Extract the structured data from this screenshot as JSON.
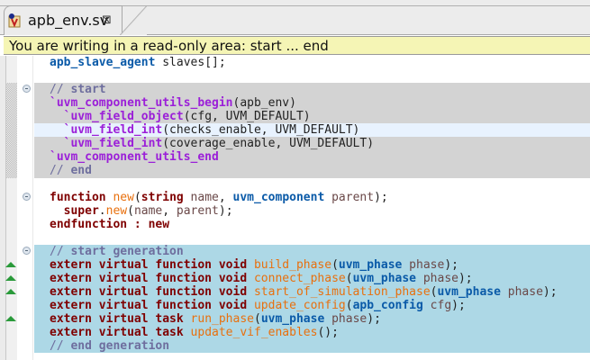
{
  "tab": {
    "label": "apb_env.sv",
    "icon": "verilog-file-icon",
    "close_icon": "close-icon"
  },
  "tooltip": {
    "text": "You are writing in a read-only area: start ... end"
  },
  "colors": {
    "readonly_block": "#d3d3d3",
    "generated_block": "#add8e6",
    "tooltip_bg": "#f5f5b5",
    "current_line": "#e8f2fe"
  },
  "code_lines": [
    [
      [
        "ty",
        "apb_slave_agent"
      ],
      [
        "p",
        " slaves[];"
      ]
    ],
    [],
    [
      [
        "cm",
        "// "
      ],
      [
        "cmb",
        "start"
      ]
    ],
    [
      [
        "mc",
        "`uvm_component_utils_begin"
      ],
      [
        "p",
        "(apb_env)"
      ]
    ],
    [
      [
        "p",
        "  "
      ],
      [
        "mc",
        "`uvm_field_object"
      ],
      [
        "p",
        "(cfg, UVM_DEFAULT)"
      ]
    ],
    [
      [
        "p",
        "  "
      ],
      [
        "mc",
        "`uvm_field_int"
      ],
      [
        "p",
        "(checks_enable, UVM_DEFAULT)"
      ]
    ],
    [
      [
        "p",
        "  "
      ],
      [
        "mc",
        "`uvm_field_int"
      ],
      [
        "p",
        "(coverage_enable, UVM_DEFAULT)"
      ]
    ],
    [
      [
        "mc",
        "`uvm_component_utils_end"
      ]
    ],
    [
      [
        "cm",
        "// "
      ],
      [
        "cmb",
        "end"
      ]
    ],
    [],
    [
      [
        "kw",
        "function"
      ],
      [
        "p",
        " "
      ],
      [
        "fn",
        "new"
      ],
      [
        "p",
        "("
      ],
      [
        "kw",
        "string"
      ],
      [
        "id",
        " name"
      ],
      [
        "p",
        ", "
      ],
      [
        "ty",
        "uvm_component"
      ],
      [
        "id",
        " parent"
      ],
      [
        "p",
        ");"
      ]
    ],
    [
      [
        "p",
        "  "
      ],
      [
        "kw",
        "super"
      ],
      [
        "p",
        "."
      ],
      [
        "fn",
        "new"
      ],
      [
        "p",
        "("
      ],
      [
        "id",
        "name"
      ],
      [
        "p",
        ", "
      ],
      [
        "id",
        "parent"
      ],
      [
        "p",
        ");"
      ]
    ],
    [
      [
        "kw",
        "endfunction"
      ],
      [
        "p",
        " "
      ],
      [
        "kw",
        ":"
      ],
      [
        "p",
        " "
      ],
      [
        "kw",
        "new"
      ]
    ],
    [],
    [
      [
        "cm",
        "// "
      ],
      [
        "cmb",
        "start generation"
      ]
    ],
    [
      [
        "kw",
        "extern virtual function void"
      ],
      [
        "p",
        " "
      ],
      [
        "fn",
        "build_phase"
      ],
      [
        "p",
        "("
      ],
      [
        "ty",
        "uvm_phase"
      ],
      [
        "id",
        " phase"
      ],
      [
        "p",
        ");"
      ]
    ],
    [
      [
        "kw",
        "extern virtual function void"
      ],
      [
        "p",
        " "
      ],
      [
        "fn",
        "connect_phase"
      ],
      [
        "p",
        "("
      ],
      [
        "ty",
        "uvm_phase"
      ],
      [
        "id",
        " phase"
      ],
      [
        "p",
        ");"
      ]
    ],
    [
      [
        "kw",
        "extern virtual function void"
      ],
      [
        "p",
        " "
      ],
      [
        "fn",
        "start_of_simulation_phase"
      ],
      [
        "p",
        "("
      ],
      [
        "ty",
        "uvm_phase"
      ],
      [
        "id",
        " phase"
      ],
      [
        "p",
        ");"
      ]
    ],
    [
      [
        "kw",
        "extern virtual function void"
      ],
      [
        "p",
        " "
      ],
      [
        "fn",
        "update_config"
      ],
      [
        "p",
        "("
      ],
      [
        "ty",
        "apb_config"
      ],
      [
        "id",
        " cfg"
      ],
      [
        "p",
        ");"
      ]
    ],
    [
      [
        "kw",
        "extern virtual task"
      ],
      [
        "p",
        " "
      ],
      [
        "fn",
        "run_phase"
      ],
      [
        "p",
        "("
      ],
      [
        "ty",
        "uvm_phase"
      ],
      [
        "id",
        " phase"
      ],
      [
        "p",
        ");"
      ]
    ],
    [
      [
        "kw",
        "extern virtual task"
      ],
      [
        "p",
        " "
      ],
      [
        "fn",
        "update_vif_enables"
      ],
      [
        "p",
        "();"
      ]
    ],
    [
      [
        "cm",
        "// "
      ],
      [
        "cmb",
        "end generation"
      ]
    ]
  ]
}
